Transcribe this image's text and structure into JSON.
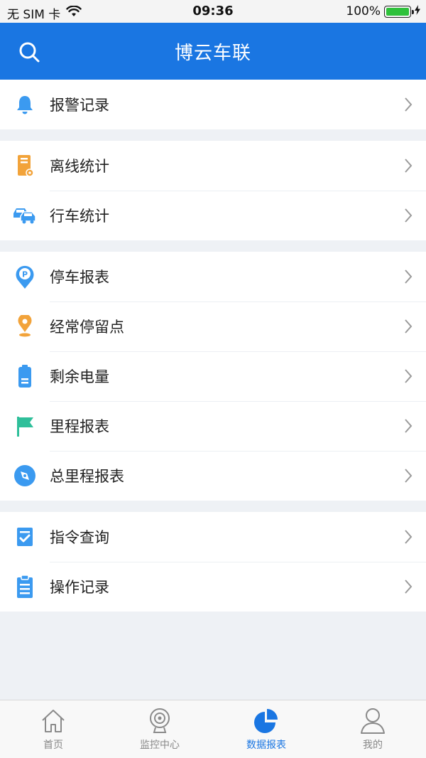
{
  "status": {
    "carrier": "无 SIM 卡",
    "time": "09:36",
    "battery": "100%",
    "battery_level": 1.0
  },
  "header": {
    "title": "博云车联"
  },
  "groups": [
    {
      "items": [
        {
          "label": "报警记录",
          "icon": "bell-icon"
        }
      ]
    },
    {
      "items": [
        {
          "label": "离线统计",
          "icon": "offline-device-icon"
        },
        {
          "label": "行车统计",
          "icon": "cars-icon"
        }
      ]
    },
    {
      "items": [
        {
          "label": "停车报表",
          "icon": "parking-pin-icon"
        },
        {
          "label": "经常停留点",
          "icon": "location-pin-icon"
        },
        {
          "label": "剩余电量",
          "icon": "battery-icon"
        },
        {
          "label": "里程报表",
          "icon": "flag-icon"
        },
        {
          "label": "总里程报表",
          "icon": "compass-icon"
        }
      ]
    },
    {
      "items": [
        {
          "label": "指令查询",
          "icon": "checklist-icon"
        },
        {
          "label": "操作记录",
          "icon": "clipboard-icon"
        }
      ]
    }
  ],
  "tabs": [
    {
      "label": "首页",
      "icon": "home-icon",
      "active": false
    },
    {
      "label": "监控中心",
      "icon": "camera-icon",
      "active": false
    },
    {
      "label": "数据报表",
      "icon": "pie-chart-icon",
      "active": true
    },
    {
      "label": "我的",
      "icon": "user-icon",
      "active": false
    }
  ],
  "colors": {
    "primary": "#1a76e2",
    "background": "#eef1f5",
    "icon_blue": "#3b9af0",
    "icon_orange": "#f2a33a",
    "icon_green": "#2fbf9a"
  }
}
